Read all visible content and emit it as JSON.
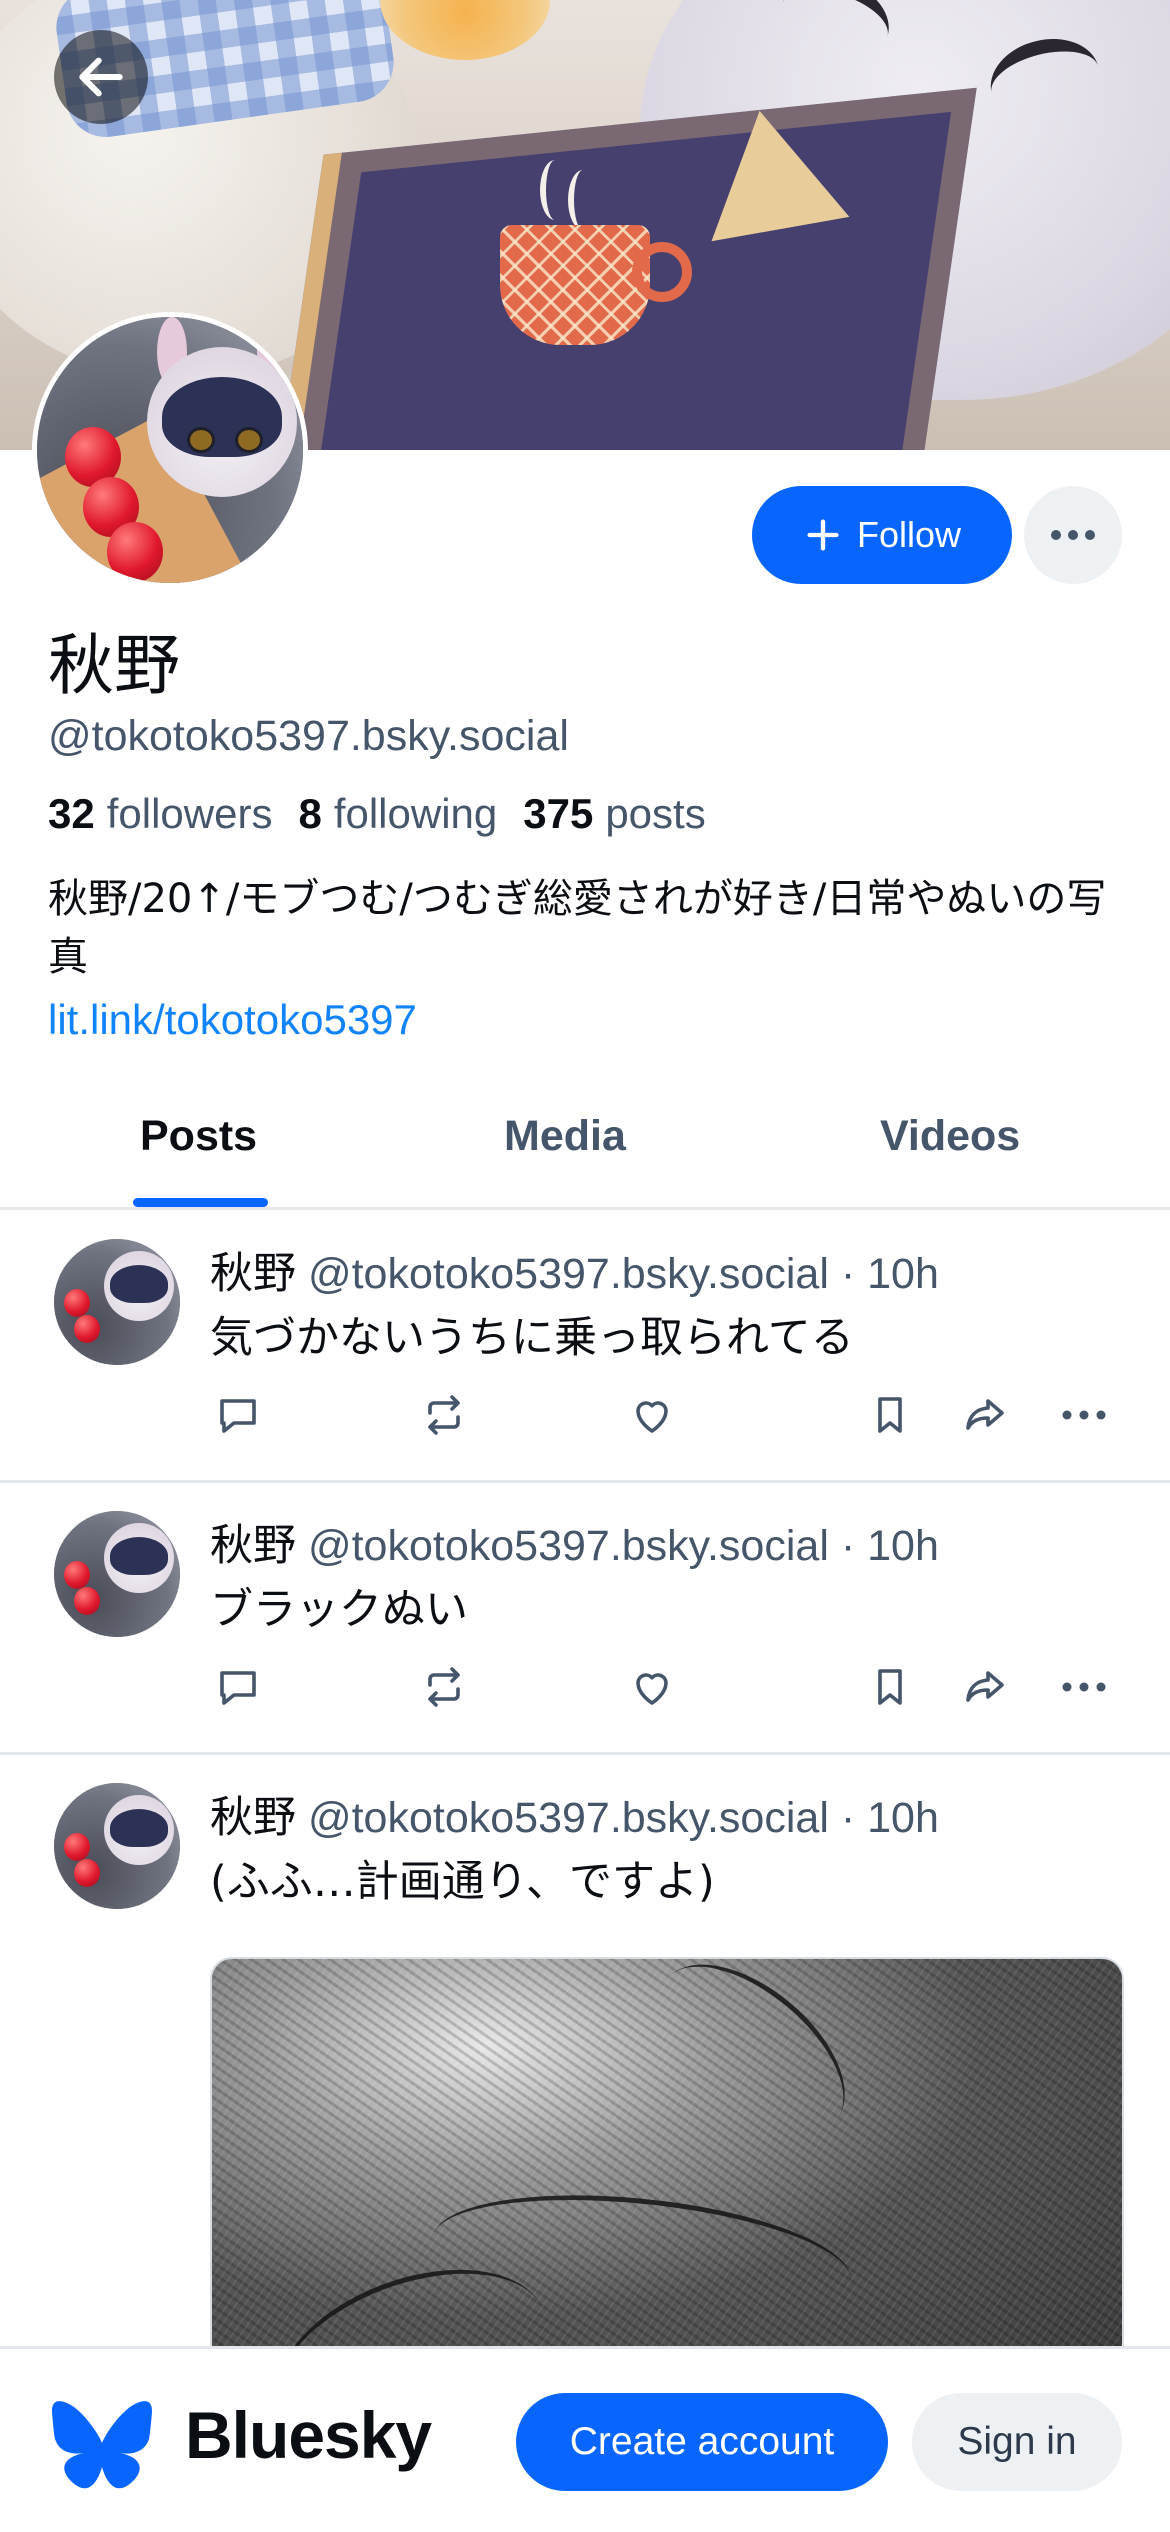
{
  "profile": {
    "display_name": "秋野",
    "handle": "@tokotoko5397.bsky.social",
    "followers_count": "32",
    "followers_label": "followers",
    "following_count": "8",
    "following_label": "following",
    "posts_count": "375",
    "posts_label": "posts",
    "bio": "秋野/20↑/モブつむ/つむぎ総愛されが好き/日常やぬいの写真",
    "link": "lit.link/tokotoko5397",
    "follow_label": "Follow"
  },
  "tabs": [
    {
      "label": "Posts",
      "active": true
    },
    {
      "label": "Media",
      "active": false
    },
    {
      "label": "Videos",
      "active": false
    }
  ],
  "posts": [
    {
      "author": "秋野",
      "handle": "@tokotoko5397.bsky.social",
      "time": "10h",
      "text": "気づかないうちに乗っ取られてる"
    },
    {
      "author": "秋野",
      "handle": "@tokotoko5397.bsky.social",
      "time": "10h",
      "text": "ブラックぬい"
    },
    {
      "author": "秋野",
      "handle": "@tokotoko5397.bsky.social",
      "time": "10h",
      "text": "(ふふ…計画通り、ですよ)"
    }
  ],
  "meta_separator": "·",
  "icons": [
    "back-arrow-icon",
    "plus-icon",
    "more-icon",
    "reply-icon",
    "repost-icon",
    "like-icon",
    "bookmark-icon",
    "share-icon",
    "butterfly-logo-icon"
  ],
  "bottom_bar": {
    "brand": "Bluesky",
    "create_account_label": "Create account",
    "sign_in_label": "Sign in"
  },
  "colors": {
    "accent": "#0866ff",
    "link": "#1083fe",
    "secondary_text": "#45556a",
    "divider": "#e4e7eb"
  }
}
